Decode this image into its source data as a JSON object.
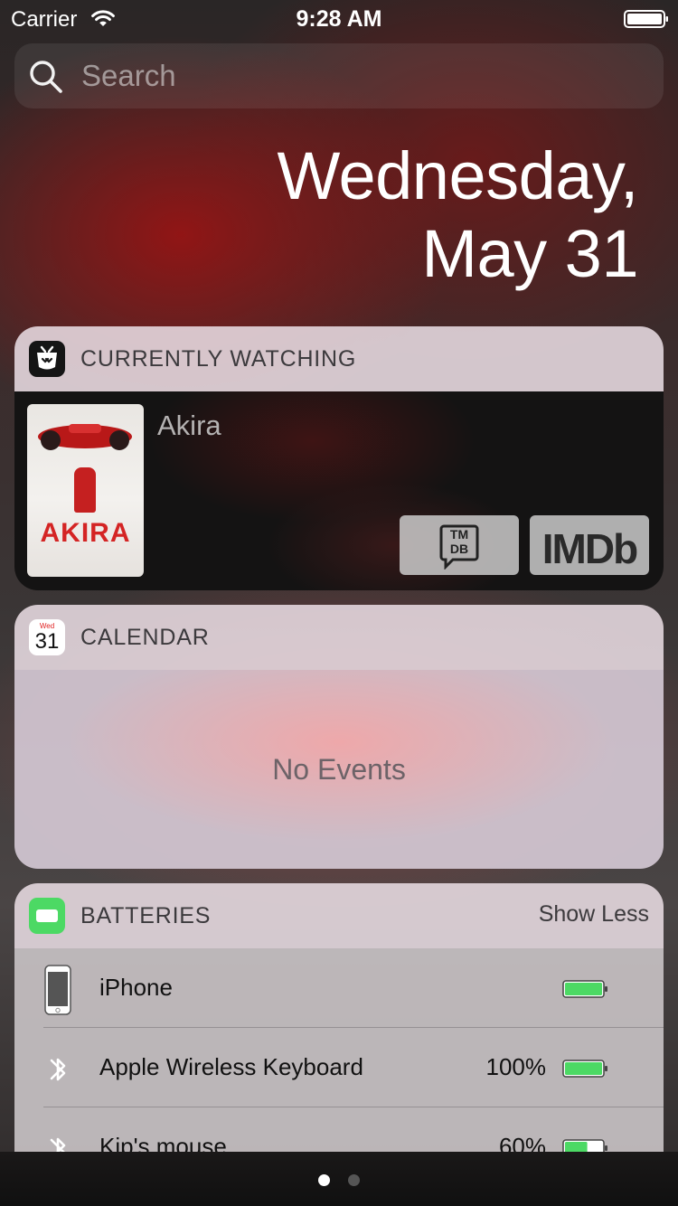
{
  "status_bar": {
    "carrier": "Carrier",
    "time": "9:28 AM"
  },
  "search": {
    "placeholder": "Search"
  },
  "date": {
    "line1": "Wednesday,",
    "line2": "May 31"
  },
  "currently_watching": {
    "title": "CURRENTLY WATCHING",
    "movie_title": "Akira",
    "poster_text": "AKIRA",
    "buttons": {
      "tmdb_top": "TM",
      "tmdb_bottom": "DB",
      "imdb": "IMDb"
    }
  },
  "calendar": {
    "title": "CALENDAR",
    "icon_day": "Wed",
    "icon_date": "31",
    "empty_text": "No Events"
  },
  "batteries": {
    "title": "BATTERIES",
    "toggle_label": "Show Less",
    "devices": [
      {
        "name": "iPhone",
        "percent": "",
        "icon": "iphone-icon",
        "level": 1.0
      },
      {
        "name": "Apple Wireless Keyboard",
        "percent": "100%",
        "icon": "bluetooth-icon",
        "level": 1.0
      },
      {
        "name": "Kip's mouse",
        "percent": "60%",
        "icon": "bluetooth-icon",
        "level": 0.6
      }
    ]
  },
  "page_indicator": {
    "pages": 2,
    "current": 1
  },
  "colors": {
    "battery_green": "#4cd964"
  }
}
